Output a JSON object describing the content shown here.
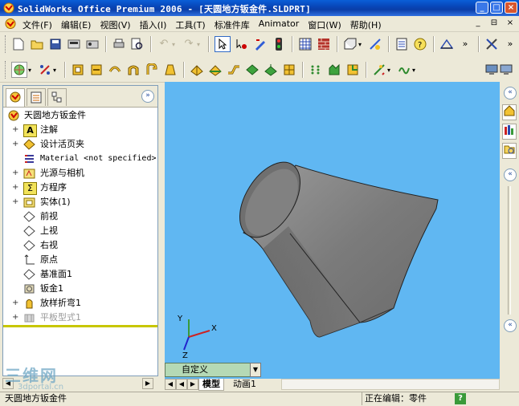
{
  "window": {
    "title": "SolidWorks Office Premium 2006 - [天圆地方钣金件.SLDPRT]",
    "buttons": [
      "_",
      "□",
      "×"
    ]
  },
  "menubar": {
    "items": [
      "文件(F)",
      "编辑(E)",
      "视图(V)",
      "插入(I)",
      "工具(T)",
      "标准件库",
      "Animator",
      "窗口(W)",
      "帮助(H)"
    ],
    "mdi_buttons": [
      "_",
      "⊟",
      "×"
    ]
  },
  "toolbar1": {
    "icons": [
      "new-icon",
      "open-icon",
      "save-icon",
      "print-setup-icon",
      "options-icon",
      "print-icon",
      "print-preview-icon",
      "undo-icon",
      "redo-icon",
      "select-icon",
      "select-other-icon",
      "sketch-edit-icon",
      "traffic-light-icon",
      "grid-icon",
      "brick-icon",
      "view-orientation-icon",
      "3d-sketch-icon",
      "properties-icon",
      "help-icon",
      "sketch-icon",
      "more-icon"
    ]
  },
  "toolbar2": {
    "icons": [
      "view-orient-icon",
      "display-style-icon",
      "sheetmetal-base-icon",
      "convert-icon",
      "sweep-icon",
      "loft-icon",
      "hem-icon",
      "jog-icon",
      "edge-flange-icon",
      "miter-icon",
      "sketched-bend-icon",
      "unfold-icon",
      "fold-icon",
      "no-bends-icon",
      "rip-icon",
      "break-corner-icon",
      "closed-corner-icon",
      "insert-bends-icon",
      "flatten-icon",
      "smart-icon"
    ]
  },
  "feature_tree": {
    "tabs": [
      "feature-manager-tab",
      "property-manager-tab",
      "configuration-manager-tab"
    ],
    "expand_glyph": "»",
    "root": "天圆地方钣金件",
    "items": [
      {
        "label": "注解",
        "icon": "A",
        "expandable": true
      },
      {
        "label": "设计活页夹",
        "icon": "◆",
        "expandable": true
      },
      {
        "label": "Material <not specified>",
        "icon": "≡",
        "expandable": false
      },
      {
        "label": "光源与相机",
        "icon": "☀",
        "expandable": true
      },
      {
        "label": "方程序",
        "icon": "Σ",
        "expandable": true
      },
      {
        "label": "实体(1)",
        "icon": "▣",
        "expandable": true
      },
      {
        "label": "前视",
        "icon": "◇",
        "expandable": false
      },
      {
        "label": "上视",
        "icon": "◇",
        "expandable": false
      },
      {
        "label": "右视",
        "icon": "◇",
        "expandable": false
      },
      {
        "label": "原点",
        "icon": "⊥",
        "expandable": false
      },
      {
        "label": "基准面1",
        "icon": "◇",
        "expandable": false
      },
      {
        "label": "钣金1",
        "icon": "▦",
        "expandable": false
      },
      {
        "label": "放样折弯1",
        "icon": "▲",
        "expandable": true
      },
      {
        "label": "平板型式1",
        "icon": "▥",
        "expandable": true,
        "dim": true
      }
    ]
  },
  "viewport": {
    "background": "#60b7f2",
    "view_dropdown": "自定义",
    "triad_labels": [
      "Y",
      "X",
      "Z"
    ]
  },
  "bottom_tabs": [
    "模型",
    "动画1"
  ],
  "right_pane": {
    "icons": [
      "home-icon",
      "design-library-icon",
      "file-explorer-icon"
    ],
    "collapse_glyph": "«"
  },
  "statusbar": {
    "left": "天圆地方钣金件",
    "right": "正在编辑：零件",
    "help": "?"
  },
  "watermark": {
    "text": "三维网",
    "url": "3dportal.cn"
  }
}
